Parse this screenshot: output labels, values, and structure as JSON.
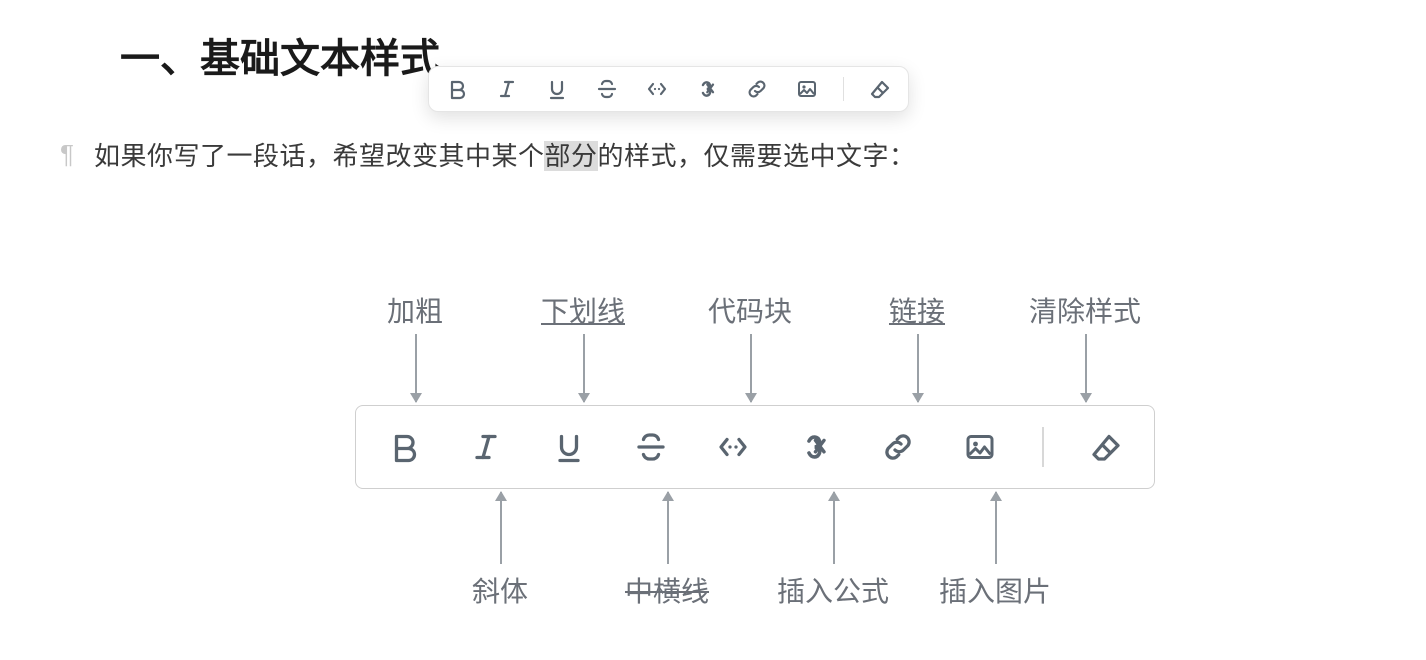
{
  "heading": "一、基础文本样式",
  "paragraph": {
    "before": "如果你写了一段话，希望改变其中某个",
    "selected": "部分",
    "after": "的样式，仅需要选中文字："
  },
  "toolbar_icons": [
    "bold",
    "italic",
    "underline",
    "strikethrough",
    "code",
    "formula",
    "link",
    "image",
    "_sep",
    "eraser"
  ],
  "labels_top": {
    "bold": "加粗",
    "underline": "下划线",
    "code": "代码块",
    "link": "链接",
    "eraser": "清除样式"
  },
  "labels_bottom": {
    "italic": "斜体",
    "strikethrough": "中横线",
    "formula": "插入公式",
    "image": "插入图片"
  }
}
